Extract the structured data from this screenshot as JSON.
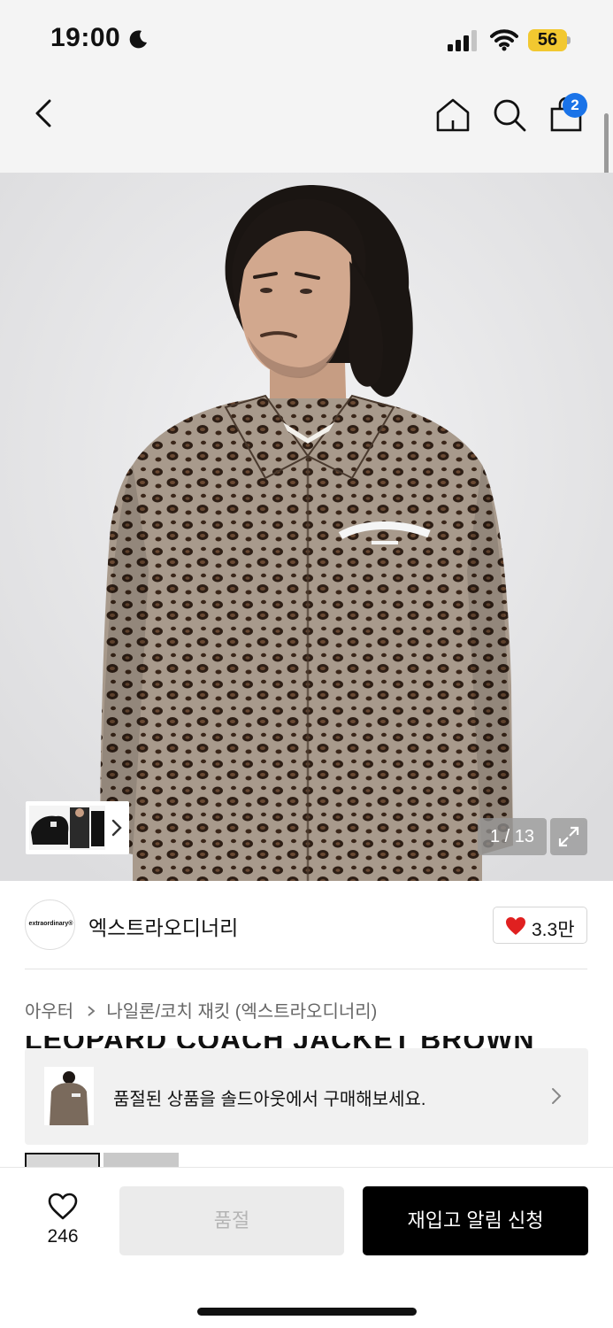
{
  "status_bar": {
    "time": "19:00",
    "battery": "56",
    "icons": [
      "moon-icon",
      "signal-icon",
      "wifi-icon",
      "battery-icon"
    ]
  },
  "nav": {
    "icons": [
      "back-icon",
      "home-icon",
      "search-icon",
      "shopping-bag-icon"
    ],
    "cart_count": "2"
  },
  "gallery": {
    "counter": "1 / 13",
    "expand_icon": "expand-icon",
    "thumbnail_arrow_icon": "chevron-right-icon"
  },
  "brand": {
    "logo_text": "extraordinary®",
    "name": "엑스트라오디너리",
    "like_count": "3.3만",
    "heart_color": "#e02020"
  },
  "breadcrumb": {
    "items": [
      "아우터",
      "나일론/코치 재킷 (엑스트라오디너리)"
    ]
  },
  "product": {
    "title": "LEOPARD COACH JACKET BROWN"
  },
  "soldout_banner": {
    "text": "품절된 상품을 솔드아웃에서 구매해보세요."
  },
  "bottom_bar": {
    "wish_count": "246",
    "soldout_label": "품절",
    "restock_label": "재입고 알림 신청"
  },
  "colors": {
    "primary_button": "#000000",
    "badge": "#1a73e8",
    "battery": "#f2c830"
  }
}
